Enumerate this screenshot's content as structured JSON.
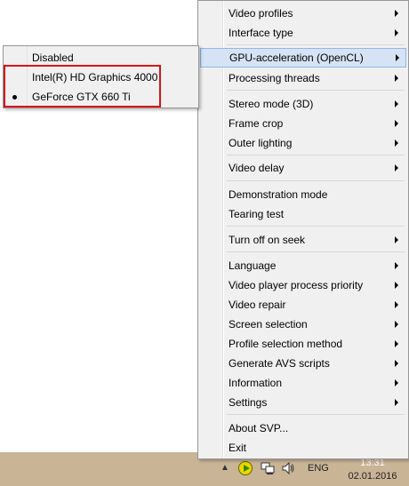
{
  "menu": {
    "items": [
      {
        "label": "Video profiles",
        "submenu": true
      },
      {
        "label": "Interface type",
        "submenu": true
      },
      {
        "label": "GPU-acceleration (OpenCL)",
        "submenu": true,
        "highlighted": true
      },
      {
        "label": "Processing threads",
        "submenu": true
      },
      {
        "label": "Stereo mode (3D)",
        "submenu": true
      },
      {
        "label": "Frame crop",
        "submenu": true
      },
      {
        "label": "Outer lighting",
        "submenu": true
      },
      {
        "label": "Video delay",
        "submenu": true
      },
      {
        "label": "Demonstration mode",
        "submenu": false
      },
      {
        "label": "Tearing test",
        "submenu": false
      },
      {
        "label": "Turn off on seek",
        "submenu": true
      },
      {
        "label": "Language",
        "submenu": true
      },
      {
        "label": "Video player process priority",
        "submenu": true
      },
      {
        "label": "Video repair",
        "submenu": true
      },
      {
        "label": "Screen selection",
        "submenu": true
      },
      {
        "label": "Profile selection method",
        "submenu": true
      },
      {
        "label": "Generate AVS scripts",
        "submenu": true
      },
      {
        "label": "Information",
        "submenu": true
      },
      {
        "label": "Settings",
        "submenu": true
      },
      {
        "label": "About SVP...",
        "submenu": false
      },
      {
        "label": "Exit",
        "submenu": false
      }
    ]
  },
  "submenu": {
    "items": [
      {
        "label": "Disabled",
        "selected": false
      },
      {
        "label": "Intel(R) HD Graphics 4000",
        "selected": false
      },
      {
        "label": "GeForce GTX 660 Ti",
        "selected": true
      }
    ]
  },
  "taskbar": {
    "language": "ENG",
    "time": "13:31",
    "date": "02.01.2016",
    "icons": [
      "show-hidden-icons-arrow",
      "svp-icon",
      "network-icon",
      "volume-icon"
    ]
  },
  "colors": {
    "menu_bg": "#f0f0f0",
    "highlight_bg": "#d5e3f5",
    "highlight_border": "#90b6e8",
    "annotation_red": "#d9161b",
    "taskbar": "#c9b496"
  }
}
